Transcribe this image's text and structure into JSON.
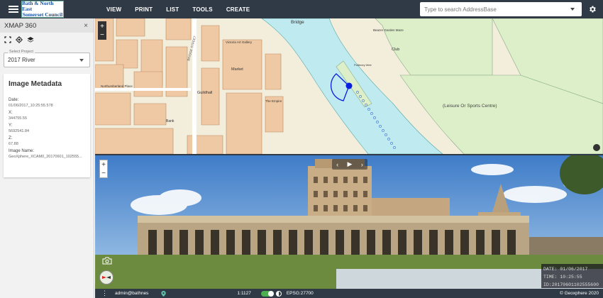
{
  "topbar": {
    "logo_line1": "Bath & North East",
    "logo_line2": "Somerset Council",
    "nav": [
      "VIEW",
      "PRINT",
      "LIST",
      "TOOLS",
      "CREATE"
    ],
    "search_placeholder": "Type to search AddressBase"
  },
  "panel": {
    "title": "XMAP 360",
    "close": "×",
    "project_label": "Select Project",
    "project_value": "2017 River",
    "metadata": {
      "title": "Image Metadata",
      "fields": [
        {
          "label": "Date:",
          "value": "01/06/2017_10:25:55.578"
        },
        {
          "label": "X:",
          "value": "344755.55"
        },
        {
          "label": "Y:",
          "value": "5692541.84"
        },
        {
          "label": "Z:",
          "value": "67.88"
        },
        {
          "label": "Image Name:",
          "value": "GeoXphere_XCAM0_20170601_102555..."
        }
      ]
    }
  },
  "map": {
    "labels": {
      "bridge": "Bridge",
      "market": "Market",
      "guildhall": "Guildhall",
      "victoria": "Victoria Art Gallery",
      "empire": "The Empire",
      "northumberland": "Northumberland Place",
      "bank": "Bank",
      "club": "Club",
      "beazer": "Beazer Garden Maze",
      "leisure": "(Leisure Or Sports Centre)",
      "weir": "Pulteney Weir",
      "bridge_street": "BRIDGE STREET"
    }
  },
  "pano": {
    "date": "DATE: 01/06/2017",
    "time": "TIME: 10:25:55",
    "id": "ID:20170601102555600"
  },
  "status": {
    "user": "admin@bathnes",
    "scale": "1:1127",
    "epsg": "EPSG:27700",
    "copyright": "© Geoxphere 2020"
  },
  "colors": {
    "header": "#2f3a46",
    "river": "#bfeaf0",
    "green": "#dcefc8",
    "building": "#efc9a4",
    "marker": "#0a1ee0"
  }
}
